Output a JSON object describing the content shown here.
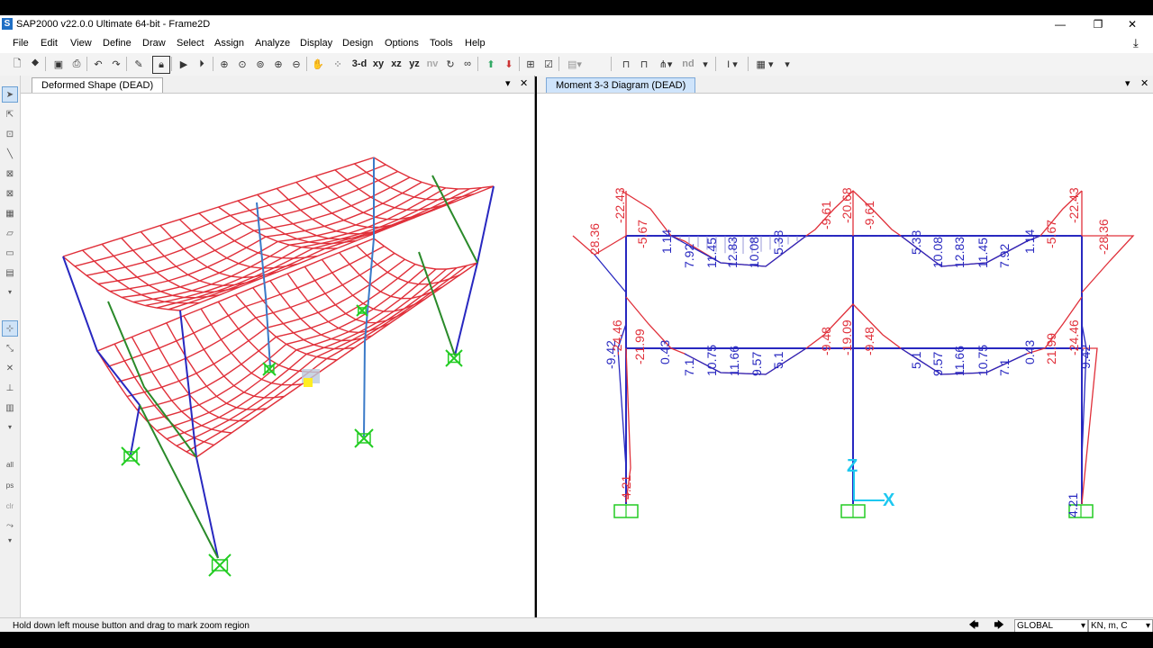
{
  "window": {
    "title": "SAP2000 v22.0.0 Ultimate 64-bit - Frame2D",
    "app_icon_letter": "S",
    "minimize": "—",
    "maximize": "❐",
    "close": "✕"
  },
  "menu": [
    "File",
    "Edit",
    "View",
    "Define",
    "Draw",
    "Select",
    "Assign",
    "Analyze",
    "Display",
    "Design",
    "Options",
    "Tools",
    "Help"
  ],
  "toolbar": {
    "view_3d": "3-d",
    "view_xy": "xy",
    "view_xz": "xz",
    "view_yz": "yz",
    "view_nv": "nv",
    "nd": "nd"
  },
  "left_panel": {
    "tab_title": "Deformed Shape (DEAD)"
  },
  "right_panel": {
    "tab_title": "Moment 3-3 Diagram (DEAD)",
    "axis_z": "Z",
    "axis_x": "X",
    "roof_labels": [
      "28.36",
      "-22.43",
      "-5.67",
      "1.14",
      "7.92",
      "11.45",
      "12.83",
      "10.08",
      "5.38",
      "-9.61",
      "-20.68",
      "-9.61",
      "5.38",
      "10.08",
      "12.83",
      "11.45",
      "7.92",
      "1.14",
      "-5.67",
      "-22.43",
      "-28.36"
    ],
    "floor_labels": [
      "-9.42",
      "-24.46",
      "-21.99",
      "0.43",
      "7.1",
      "10.75",
      "11.66",
      "9.57",
      "5.1",
      "-9.48",
      "-19.09",
      "-9.48",
      "5.1",
      "9.57",
      "11.66",
      "10.75",
      "7.1",
      "0.43",
      "21.99",
      "-24.46",
      "9.42"
    ],
    "base_labels": [
      "4.21",
      "4.21"
    ]
  },
  "status": {
    "message": "Hold down left mouse button and drag to mark zoom region",
    "coord_system": "GLOBAL",
    "units": "KN, m, C"
  },
  "colors": {
    "moment_red": "#e0303a",
    "frame_blue": "#2828c0",
    "support_green": "#22cc22",
    "axis_cyan": "#1ec8f0",
    "active_tab": "#cfe4fb"
  }
}
